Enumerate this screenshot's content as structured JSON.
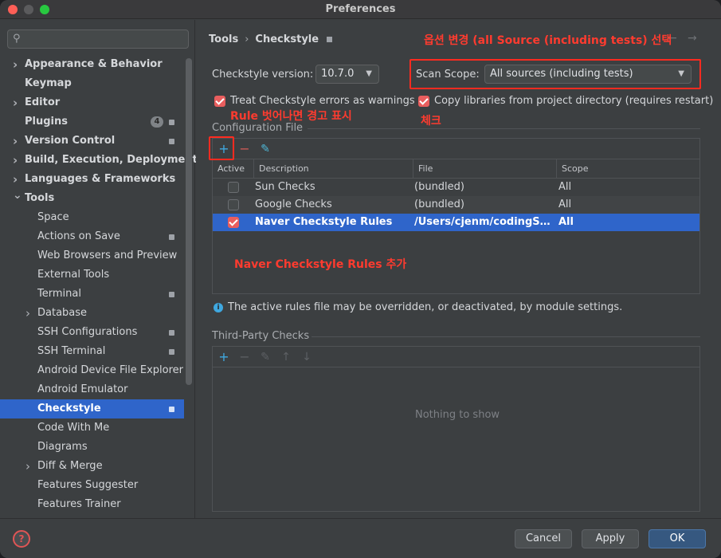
{
  "window": {
    "title": "Preferences"
  },
  "sidebar": {
    "search_placeholder": "",
    "items": [
      {
        "label": "Appearance & Behavior",
        "level": 0,
        "expandable": true,
        "expanded": false,
        "bold": true
      },
      {
        "label": "Keymap",
        "level": 0,
        "bold": true
      },
      {
        "label": "Editor",
        "level": 0,
        "expandable": true,
        "bold": true
      },
      {
        "label": "Plugins",
        "level": 0,
        "bold": true,
        "badge": "4",
        "pin": true
      },
      {
        "label": "Version Control",
        "level": 0,
        "expandable": true,
        "bold": true,
        "pin": true
      },
      {
        "label": "Build, Execution, Deployment",
        "level": 0,
        "expandable": true,
        "bold": true
      },
      {
        "label": "Languages & Frameworks",
        "level": 0,
        "expandable": true,
        "bold": true
      },
      {
        "label": "Tools",
        "level": 0,
        "expandable": true,
        "expanded": true,
        "bold": true
      },
      {
        "label": "Space",
        "level": 1
      },
      {
        "label": "Actions on Save",
        "level": 1,
        "pin": true
      },
      {
        "label": "Web Browsers and Preview",
        "level": 1
      },
      {
        "label": "External Tools",
        "level": 1
      },
      {
        "label": "Terminal",
        "level": 1,
        "pin": true
      },
      {
        "label": "Database",
        "level": 1,
        "expandable": true
      },
      {
        "label": "SSH Configurations",
        "level": 1,
        "pin": true
      },
      {
        "label": "SSH Terminal",
        "level": 1,
        "pin": true
      },
      {
        "label": "Android Device File Explorer",
        "level": 1
      },
      {
        "label": "Android Emulator",
        "level": 1
      },
      {
        "label": "Checkstyle",
        "level": 1,
        "selected": true,
        "pin": true
      },
      {
        "label": "Code With Me",
        "level": 1
      },
      {
        "label": "Diagrams",
        "level": 1
      },
      {
        "label": "Diff & Merge",
        "level": 1,
        "expandable": true
      },
      {
        "label": "Features Suggester",
        "level": 1
      },
      {
        "label": "Features Trainer",
        "level": 1
      }
    ]
  },
  "breadcrumb": {
    "parent": "Tools",
    "separator": "›",
    "current": "Checkstyle"
  },
  "nav": {
    "back": "←",
    "forward": "→"
  },
  "settings": {
    "version_label": "Checkstyle version:",
    "version_value": "10.7.0",
    "scope_label": "Scan Scope:",
    "scope_value": "All sources (including tests)",
    "treat_errors_label": "Treat Checkstyle errors as warnings",
    "treat_errors_checked": true,
    "copy_libs_label": "Copy libraries from project directory (requires restart)",
    "copy_libs_checked": true
  },
  "config": {
    "section_title": "Configuration File",
    "toolbar": {
      "add": "+",
      "remove": "−",
      "edit": "✎"
    },
    "columns": [
      "Active",
      "Description",
      "File",
      "Scope"
    ],
    "rows": [
      {
        "active": false,
        "description": "Sun Checks",
        "file": "(bundled)",
        "scope": "All"
      },
      {
        "active": false,
        "description": "Google Checks",
        "file": "(bundled)",
        "scope": "All"
      },
      {
        "active": true,
        "description": "Naver Checkstyle Rules",
        "file": "/Users/cjenm/codingStyle/...",
        "scope": "All",
        "selected": true
      }
    ],
    "info": "The active rules file may be overridden, or deactivated, by module settings."
  },
  "third_party": {
    "section_title": "Third-Party Checks",
    "toolbar": {
      "add": "+",
      "remove": "−",
      "edit": "✎",
      "up": "↑",
      "down": "↓"
    },
    "empty_text": "Nothing to show"
  },
  "annotations": {
    "scope": "옵션 변경 (all Source (including tests) 선택",
    "treat_errors": "Rule 벗어나면 경고 표시",
    "copy_libs": "체크",
    "add_rules": "Naver Checkstyle Rules 추가"
  },
  "footer": {
    "help": "?",
    "cancel": "Cancel",
    "apply": "Apply",
    "ok": "OK"
  },
  "colors": {
    "accent": "#2f65ca",
    "checkbox": "#e95e5e",
    "annotation": "#ff3b2f"
  }
}
